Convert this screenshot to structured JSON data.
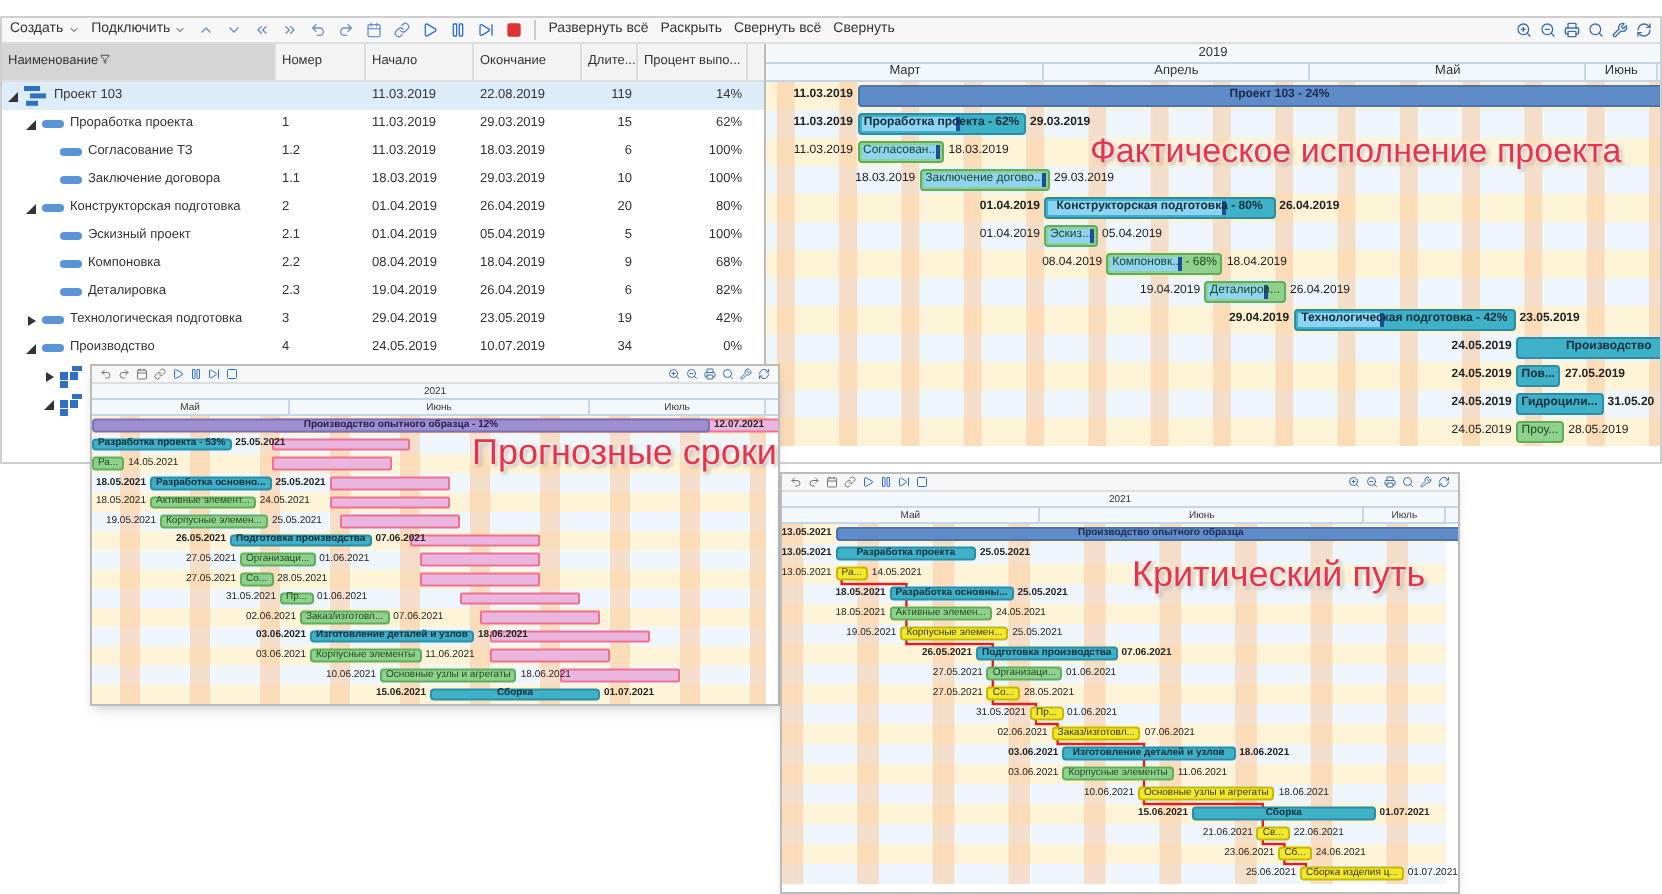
{
  "toolbar": {
    "buttons": [
      "Создать",
      "Подключить"
    ],
    "links": [
      "Развернуть всё",
      "Раскрыть",
      "Свернуть всё",
      "Свернуть"
    ]
  },
  "grid": {
    "columns": [
      "Наименование",
      "Номер",
      "Начало",
      "Окончание",
      "Длите...",
      "Процент выпо..."
    ],
    "rows": [
      {
        "kind": "project",
        "name": "Проект 103",
        "number": "",
        "start": "11.03.2019",
        "end": "22.08.2019",
        "duration": "119",
        "percent": "14%",
        "expanded": true,
        "selected": true,
        "children": [
          {
            "kind": "task",
            "name": "Проработка проекта",
            "number": "1",
            "start": "11.03.2019",
            "end": "29.03.2019",
            "duration": "15",
            "percent": "62%",
            "expanded": true,
            "selected": false,
            "children": [
              {
                "kind": "task",
                "name": "Согласование ТЗ",
                "number": "1.2",
                "start": "11.03.2019",
                "end": "18.03.2019",
                "duration": "6",
                "percent": "100%",
                "selected": false
              },
              {
                "kind": "task",
                "name": "Заключение договора",
                "number": "1.1",
                "start": "18.03.2019",
                "end": "29.03.2019",
                "duration": "10",
                "percent": "100%",
                "selected": false
              }
            ]
          },
          {
            "kind": "task",
            "name": "Конструкторская подготовка",
            "number": "2",
            "start": "01.04.2019",
            "end": "26.04.2019",
            "duration": "20",
            "percent": "80%",
            "expanded": true,
            "selected": false,
            "children": [
              {
                "kind": "task",
                "name": "Эскизный проект",
                "number": "2.1",
                "start": "01.04.2019",
                "end": "05.04.2019",
                "duration": "5",
                "percent": "100%",
                "selected": false
              },
              {
                "kind": "task",
                "name": "Компоновка",
                "number": "2.2",
                "start": "08.04.2019",
                "end": "18.04.2019",
                "duration": "9",
                "percent": "68%",
                "selected": false
              },
              {
                "kind": "task",
                "name": "Деталировка",
                "number": "2.3",
                "start": "19.04.2019",
                "end": "26.04.2019",
                "duration": "6",
                "percent": "82%",
                "selected": false
              }
            ]
          },
          {
            "kind": "task",
            "name": "Технологическая подготовка",
            "number": "3",
            "start": "29.04.2019",
            "end": "23.05.2019",
            "duration": "19",
            "percent": "42%",
            "expanded": false,
            "selected": false
          },
          {
            "kind": "task",
            "name": "Производство",
            "number": "4",
            "start": "24.05.2019",
            "end": "10.07.2019",
            "duration": "34",
            "percent": "0%",
            "expanded": true,
            "selected": false,
            "children": [
              {
                "kind": "block",
                "expanded": false,
                "selected": false
              },
              {
                "kind": "block",
                "expanded": true,
                "selected": false
              }
            ]
          }
        ]
      }
    ]
  },
  "main_gantt": {
    "year": "2019",
    "months": [
      "Март",
      "Апрель",
      "Май",
      "Июнь"
    ],
    "rows": [
      {
        "kind": "summary",
        "start": "11.03.2019",
        "label": "Проект 103 - 24%"
      },
      {
        "kind": "task",
        "start": "11.03.2019",
        "label": "Проработка проекта - 62%",
        "end": "29.03.2019",
        "level": 0.62
      },
      {
        "kind": "subtask",
        "start": "11.03.2019",
        "label": "Согласован...",
        "end": "18.03.2019",
        "level": 1
      },
      {
        "kind": "subtask",
        "start": "18.03.2019",
        "label": "Заключение догово...",
        "end": "29.03.2019",
        "level": 1
      },
      {
        "kind": "task",
        "start": "01.04.2019",
        "label": "Конструкторская подготовка - 80%",
        "end": "26.04.2019",
        "level": 0.8
      },
      {
        "kind": "subtask",
        "start": "01.04.2019",
        "label": "Эскиз...",
        "end": "05.04.2019",
        "level": 1
      },
      {
        "kind": "subtask",
        "start": "08.04.2019",
        "label": "Компоновк... - 68%",
        "end": "18.04.2019",
        "level": 0.68
      },
      {
        "kind": "subtask",
        "start": "19.04.2019",
        "label": "Деталиров...",
        "end": "26.04.2019",
        "level": 0.82
      },
      {
        "kind": "task",
        "start": "29.04.2019",
        "label": "Технологическая подготовка - 42%",
        "end": "23.05.2019",
        "level": 0.42
      },
      {
        "kind": "task",
        "start": "24.05.2019",
        "label": "Производство"
      },
      {
        "kind": "task",
        "start": "24.05.2019",
        "label": "Пов...",
        "end": "27.05.2019"
      },
      {
        "kind": "task",
        "start": "24.05.2019",
        "label": "Гидроцили...",
        "end": "31.05.20"
      },
      {
        "kind": "subtask",
        "start": "24.05.2019",
        "label": "Проу...",
        "end": "28.05.2019"
      }
    ]
  },
  "callouts": [
    "Фактическое исполнение проекта",
    "Прогнозные сроки",
    "Критический путь"
  ],
  "forecast_view": {
    "year": "2021",
    "months": [
      "Май",
      "Июнь",
      "Июль"
    ],
    "rows": [
      {
        "kind": "purple",
        "label": "Производство опытного образца - 12%",
        "end": "12.07.2021",
        "forecast": true
      },
      {
        "kind": "task",
        "label": "Разработка проекта - 53%",
        "end": "25.05.2021",
        "forecast": true
      },
      {
        "kind": "subtask",
        "label": "Ра...",
        "end": "14.05.2021",
        "forecast": true
      },
      {
        "kind": "task",
        "start": "18.05.2021",
        "label": "Разработка основно...",
        "end": "25.05.2021",
        "forecast": true
      },
      {
        "kind": "subtask",
        "start": "18.05.2021",
        "label": "Активные элемент...",
        "end": "24.05.2021",
        "forecast": true
      },
      {
        "kind": "subtask",
        "start": "19.05.2021",
        "label": "Корпусные элемен...",
        "end": "25.05.2021",
        "forecast": true
      },
      {
        "kind": "task",
        "start": "26.05.2021",
        "label": "Подготовка производства",
        "end": "07.06.2021",
        "forecast": true
      },
      {
        "kind": "subtask",
        "start": "27.05.2021",
        "label": "Организаци...",
        "end": "01.06.2021",
        "forecast": true
      },
      {
        "kind": "subtask",
        "start": "27.05.2021",
        "label": "Со...",
        "end": "28.05.2021",
        "forecast": true
      },
      {
        "kind": "subtask",
        "start": "31.05.2021",
        "label": "Пр...",
        "end": "01.06.2021",
        "forecast": true
      },
      {
        "kind": "subtask",
        "start": "02.06.2021",
        "label": "Заказ/изготовл...",
        "end": "07.06.2021",
        "forecast": true
      },
      {
        "kind": "task",
        "start": "03.06.2021",
        "label": "Изготовление деталей и узлов",
        "end": "18.06.2021",
        "forecast": true
      },
      {
        "kind": "subtask",
        "start": "03.06.2021",
        "label": "Корпусные элементы",
        "end": "11.06.2021",
        "forecast": true
      },
      {
        "kind": "subtask",
        "start": "10.06.2021",
        "label": "Основные узлы и агрегаты",
        "end": "18.06.2021",
        "forecast": true
      },
      {
        "kind": "task",
        "start": "15.06.2021",
        "label": "Сборка",
        "end": "01.07.2021",
        "forecast": false
      }
    ]
  },
  "critical_view": {
    "year": "2021",
    "months": [
      "Май",
      "Июнь",
      "Июль"
    ],
    "rows": [
      {
        "kind": "summary",
        "start": "13.05.2021",
        "label": "Производство опытного образца"
      },
      {
        "kind": "task",
        "start": "13.05.2021",
        "label": "Разработка проекта",
        "end": "25.05.2021"
      },
      {
        "kind": "critical",
        "start": "13.05.2021",
        "label": "Ра...",
        "end": "14.05.2021"
      },
      {
        "kind": "task",
        "start": "18.05.2021",
        "label": "Разработка основны...",
        "end": "25.05.2021"
      },
      {
        "kind": "subtask",
        "start": "18.05.2021",
        "label": "Активные элемен...",
        "end": "24.05.2021"
      },
      {
        "kind": "critical",
        "start": "19.05.2021",
        "label": "Корпусные элемен...",
        "end": "25.05.2021"
      },
      {
        "kind": "task",
        "start": "26.05.2021",
        "label": "Подготовка производства",
        "end": "07.06.2021"
      },
      {
        "kind": "subtask",
        "start": "27.05.2021",
        "label": "Организаци...",
        "end": "01.06.2021"
      },
      {
        "kind": "critical",
        "start": "27.05.2021",
        "label": "Со...",
        "end": "28.05.2021"
      },
      {
        "kind": "critical",
        "start": "31.05.2021",
        "label": "Пр...",
        "end": "01.06.2021"
      },
      {
        "kind": "critical",
        "start": "02.06.2021",
        "label": "Заказ/изготовл...",
        "end": "07.06.2021"
      },
      {
        "kind": "task",
        "start": "03.06.2021",
        "label": "Изготовление деталей и узлов",
        "end": "18.06.2021"
      },
      {
        "kind": "subtask",
        "start": "03.06.2021",
        "label": "Корпусные элементы",
        "end": "11.06.2021"
      },
      {
        "kind": "critical",
        "start": "10.06.2021",
        "label": "Основные узлы и агрегаты",
        "end": "18.06.2021"
      },
      {
        "kind": "task",
        "start": "15.06.2021",
        "label": "Сборка",
        "end": "01.07.2021"
      },
      {
        "kind": "critical",
        "start": "21.06.2021",
        "label": "Св...",
        "end": "22.06.2021"
      },
      {
        "kind": "critical",
        "start": "23.06.2021",
        "label": "Сб...",
        "end": "24.06.2021"
      },
      {
        "kind": "critical",
        "start": "25.06.2021",
        "label": "Сборка изделия ц...",
        "end": "01.07.2021"
      }
    ]
  }
}
